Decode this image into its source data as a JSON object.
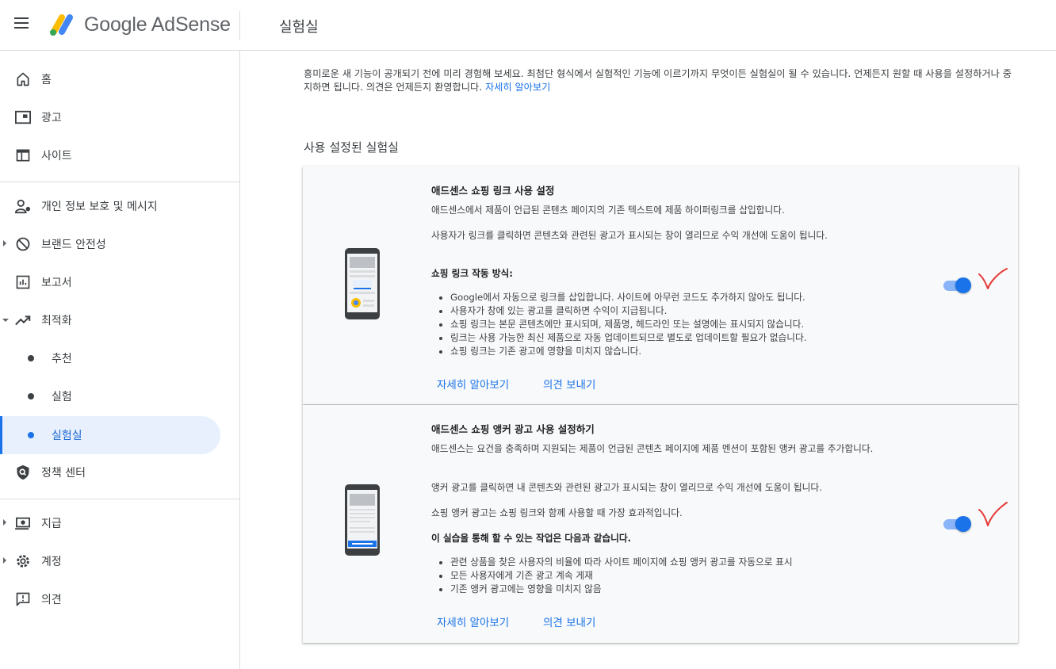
{
  "header": {
    "brand": "Google AdSense",
    "page_title": "실험실"
  },
  "sidebar": {
    "items": [
      {
        "label": "홈",
        "icon": "home-icon"
      },
      {
        "label": "광고",
        "icon": "ads-icon"
      },
      {
        "label": "사이트",
        "icon": "sites-icon"
      },
      {
        "label": "개인 정보 보호 및 메시지",
        "icon": "privacy-messaging-icon"
      },
      {
        "label": "브랜드 안전성",
        "icon": "block-icon"
      },
      {
        "label": "보고서",
        "icon": "reports-icon"
      },
      {
        "label": "최적화",
        "icon": "trending-up-icon"
      },
      {
        "label": "추천"
      },
      {
        "label": "실험"
      },
      {
        "label": "실험실"
      },
      {
        "label": "정책 센터",
        "icon": "policy-shield-icon"
      },
      {
        "label": "지급",
        "icon": "payments-icon"
      },
      {
        "label": "계정",
        "icon": "gear-icon"
      },
      {
        "label": "의견",
        "icon": "feedback-icon"
      }
    ]
  },
  "main": {
    "intro_text": "흥미로운 새 기능이 공개되기 전에 미리 경험해 보세요. 최첨단 형식에서 실험적인 기능에 이르기까지 무엇이든 실험실이 될 수 있습니다. 언제든지 원할 때 사용을 설정하거나 중지하면 됩니다. 의견은 언제든지 환영합니다.",
    "intro_link": "자세히 알아보기",
    "section_title": "사용 설정된 실험실",
    "cards": [
      {
        "title": "애드센스 쇼핑 링크 사용 설정",
        "p1": "애드센스에서 제품이 언급된 콘텐츠 페이지의 기존 텍스트에 제품 하이퍼링크를 삽입합니다.",
        "p2": "사용자가 링크를 클릭하면 콘텐츠와 관련된 광고가 표시되는 창이 열리므로 수익 개선에 도움이 됩니다.",
        "subheading": "쇼핑 링크 작동 방식:",
        "bullets": [
          "Google에서 자동으로 링크를 삽입합니다. 사이트에 아무런 코드도 추가하지 않아도 됩니다.",
          "사용자가 창에 있는 광고를 클릭하면 수익이 지급됩니다.",
          "쇼핑 링크는 본문 콘텐츠에만 표시되며, 제품명, 헤드라인 또는 설명에는 표시되지 않습니다.",
          "링크는 사용 가능한 최신 제품으로 자동 업데이트되므로 별도로 업데이트할 필요가 없습니다.",
          "쇼핑 링크는 기존 광고에 영향을 미치지 않습니다."
        ],
        "learn_more": "자세히 알아보기",
        "feedback": "의견 보내기",
        "enabled": true
      },
      {
        "title": "애드센스 쇼핑 앵커 광고 사용 설정하기",
        "p1": "애드센스는 요건을 충족하며 지원되는 제품이 언급된 콘텐츠 페이지에 제품 멘션이 포함된 앵커 광고를 추가합니다.",
        "p2": "앵커 광고를 클릭하면 내 콘텐츠와 관련된 광고가 표시되는 창이 열리므로 수익 개선에 도움이 됩니다.",
        "p3": "쇼핑 앵커 광고는 쇼핑 링크와 함께 사용할 때 가장 효과적입니다.",
        "subheading": "이 실습을 통해 할 수 있는 작업은 다음과 같습니다.",
        "bullets": [
          "관련 상품을 찾은 사용자의 비율에 따라 사이트 페이지에 쇼핑 앵커 광고를 자동으로 표시",
          "모든 사용자에게 기존 광고 계속 게재",
          "기존 앵커 광고에는 영향을 미치지 않음"
        ],
        "learn_more": "자세히 알아보기",
        "feedback": "의견 보내기",
        "enabled": true
      }
    ]
  },
  "colors": {
    "accent": "#1a73e8",
    "annotation": "#e53935"
  }
}
